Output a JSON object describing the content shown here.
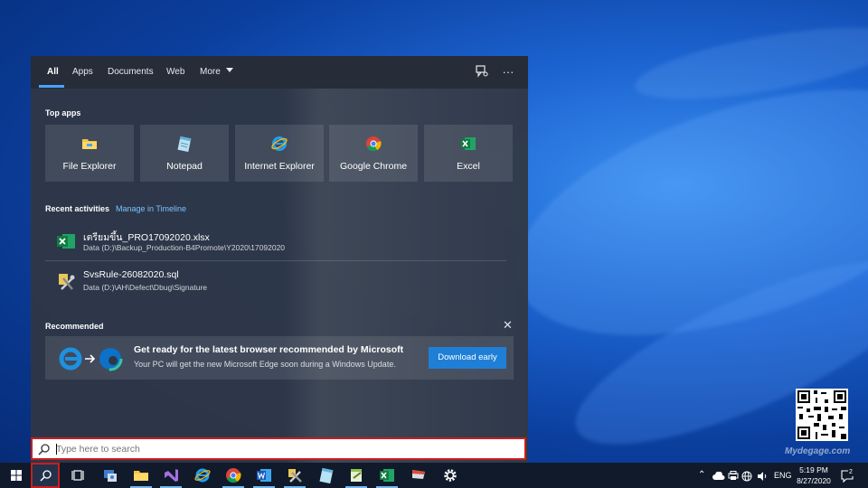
{
  "search_panel": {
    "tabs": [
      {
        "label": "All",
        "active": true
      },
      {
        "label": "Apps"
      },
      {
        "label": "Documents"
      },
      {
        "label": "Web"
      },
      {
        "label": "More"
      }
    ],
    "icons": {
      "feedback": "feedback-icon",
      "more_options": "ellipsis-icon"
    },
    "top_apps_title": "Top apps",
    "top_apps": [
      {
        "label": "File Explorer",
        "icon": "folder-icon"
      },
      {
        "label": "Notepad",
        "icon": "notepad-icon"
      },
      {
        "label": "Internet Explorer",
        "icon": "internet-explorer-icon"
      },
      {
        "label": "Google Chrome",
        "icon": "chrome-icon"
      },
      {
        "label": "Excel",
        "icon": "excel-icon"
      }
    ],
    "recent_title": "Recent activities",
    "manage_timeline": "Manage in Timeline",
    "recent": [
      {
        "name": "เตรียมขึ้น_PRO17092020.xlsx",
        "path": "Data (D:)\\Backup_Production-B4Promote\\Y2020\\17092020",
        "icon": "excel-file-icon"
      },
      {
        "name": "SvsRule-26082020.sql",
        "path": "Data (D:)\\AH\\Defect\\Dbug\\Signature",
        "icon": "sql-file-icon"
      }
    ],
    "recommended_title": "Recommended",
    "recommended": {
      "title": "Get ready for the latest browser recommended by Microsoft",
      "subtitle": "Your PC will get the new Microsoft Edge soon during a Windows Update.",
      "button": "Download early"
    }
  },
  "search_box": {
    "placeholder": "Type here to search",
    "value": ""
  },
  "taskbar": {
    "apps": [
      "task-view-icon",
      "control-panel-icon",
      "file-explorer-icon",
      "visual-studio-icon",
      "internet-explorer-icon",
      "chrome-icon",
      "word-icon",
      "tools-icon",
      "notepad-icon",
      "notepad-plus-icon",
      "excel-icon",
      "presentation-icon",
      "settings-icon"
    ],
    "language": "ENG",
    "time": "5:19 PM",
    "date": "8/27/2020",
    "notification_count": "2"
  },
  "watermark": "Mydegage.com",
  "colors": {
    "accent": "#4aa3ff",
    "highlight_border": "#c81e1e",
    "button_blue": "#1f7fd6"
  }
}
